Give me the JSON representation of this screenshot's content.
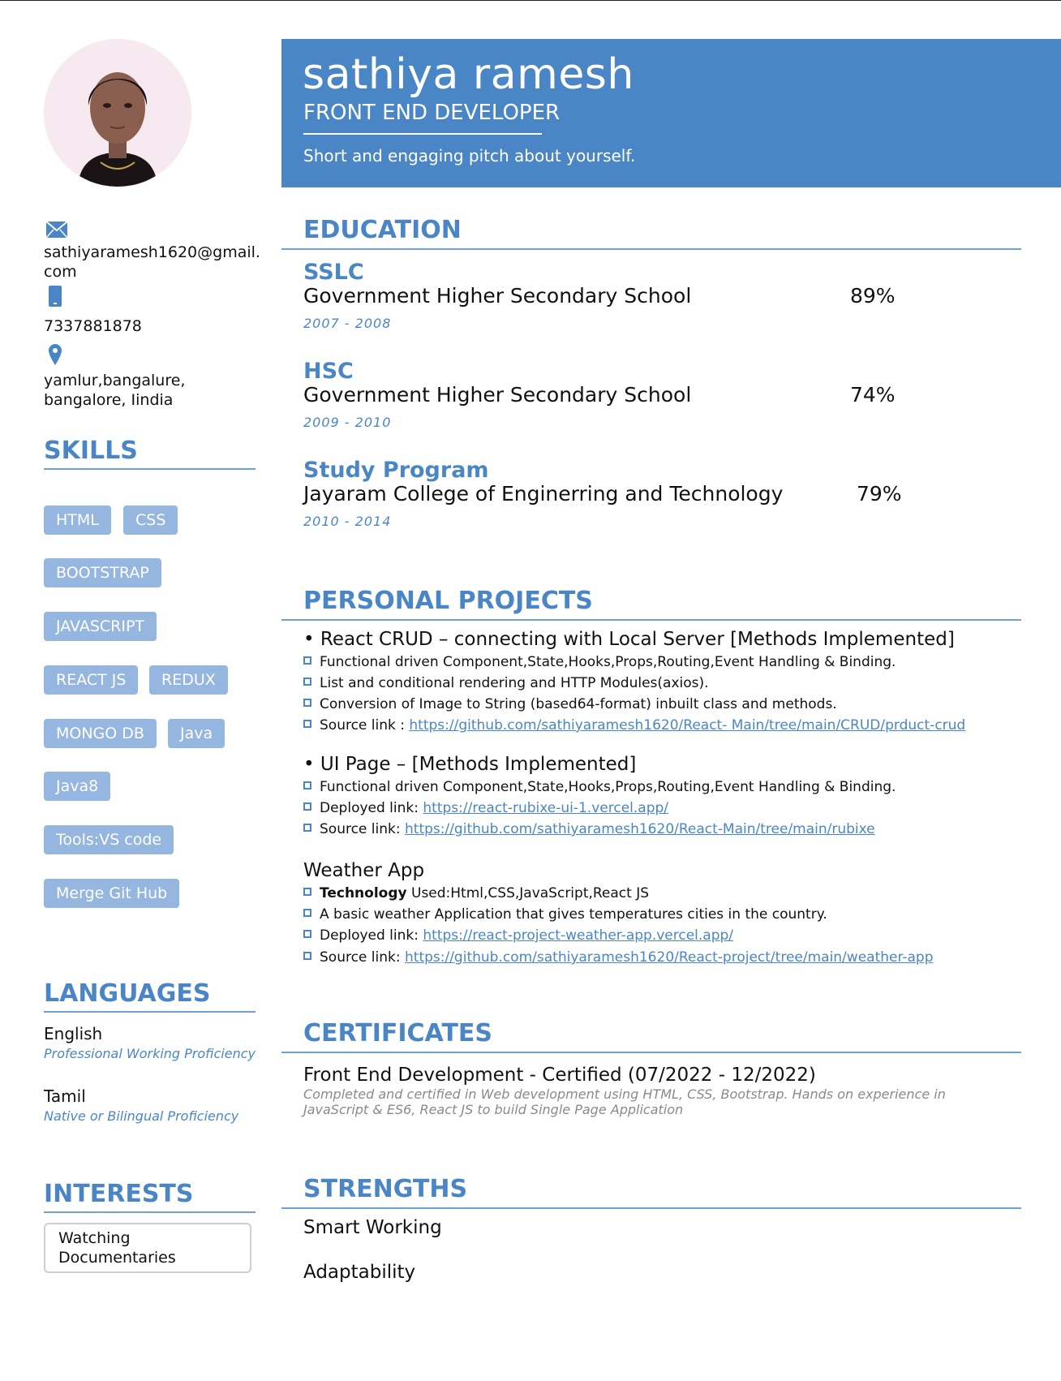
{
  "profile": {
    "name": "sathiya ramesh",
    "role": "FRONT END DEVELOPER",
    "pitch": "Short and engaging pitch about yourself."
  },
  "contact": {
    "email": "sathiyaramesh1620@gmail.com",
    "phone": "7337881878",
    "address_line1": "yamlur,bangalure,",
    "address_line2": "bangalore, Iindia",
    "icons": [
      "envelope-icon",
      "phone-icon",
      "location-pin-icon"
    ]
  },
  "skills": {
    "heading": "SKILLS",
    "items": [
      "HTML",
      "CSS",
      "BOOTSTRAP",
      "JAVASCRIPT",
      "REACT JS",
      "REDUX",
      "MONGO DB",
      "Java",
      "Java8",
      "Tools:VS code",
      "Merge Git Hub"
    ]
  },
  "languages": {
    "heading": "LANGUAGES",
    "items": [
      {
        "name": "English",
        "level": "Professional Working Proficiency"
      },
      {
        "name": "Tamil",
        "level": "Native or Bilingual Proficiency"
      }
    ]
  },
  "interests": {
    "heading": "INTERESTS",
    "items": [
      "Watching Documentaries"
    ]
  },
  "education": {
    "heading": "EDUCATION",
    "items": [
      {
        "level": "SSLC",
        "school": "Government Higher Secondary School",
        "score": "89%",
        "years": "2007 - 2008"
      },
      {
        "level": "HSC",
        "school": "Government Higher Secondary School",
        "score": "74%",
        "years": "2009 - 2010"
      },
      {
        "level": "Study Program",
        "school": "Jayaram College of Enginerring and Technology",
        "score": "79%",
        "years": "2010 - 2014"
      }
    ]
  },
  "projects": {
    "heading": "PERSONAL PROJECTS",
    "items": [
      {
        "title": "• React CRUD – connecting with Local Server [Methods Implemented]",
        "bullets": [
          "Functional driven Component,State,Hooks,Props,Routing,Event Handling & Binding.",
          "List and conditional rendering and HTTP Modules(axios).",
          "Conversion of Image to String (based64-format) inbuilt class and methods."
        ],
        "source_label": "Source link : ",
        "source_url": "https://github.com/sathiyaramesh1620/React- Main/tree/main/CRUD/prduct-crud"
      },
      {
        "title": "• UI Page – [Methods Implemented]",
        "bullets": [
          "Functional driven Component,State,Hooks,Props,Routing,Event Handling & Binding."
        ],
        "deployed_label": "Deployed link: ",
        "deployed_url": "https://react-rubixe-ui-1.vercel.app/",
        "source_label": "Source link: ",
        "source_url": "https://github.com/sathiyaramesh1620/React-Main/tree/main/rubixe"
      },
      {
        "title": "Weather App",
        "tech_label": "Technology",
        "tech_value": " Used:Html,CSS,JavaScript,React JS",
        "bullets": [
          "A basic weather Application that gives temperatures cities in the country."
        ],
        "deployed_label": "Deployed link: ",
        "deployed_url": "https://react-project-weather-app.vercel.app/",
        "source_label": "Source link: ",
        "source_url": "https://github.com/sathiyaramesh1620/React-project/tree/main/weather-app"
      }
    ]
  },
  "certificates": {
    "heading": "CERTIFICATES",
    "items": [
      {
        "title": "Front End Development - Certified (07/2022 - 12/2022)",
        "description": "Completed and certified in Web development using HTML, CSS, Bootstrap. Hands on experience in JavaScript & ES6, React JS to build Single Page Application"
      }
    ]
  },
  "strengths": {
    "heading": "STRENGTHS",
    "items": [
      "Smart Working",
      "Adaptability"
    ]
  },
  "colors": {
    "accent": "#4a86c6",
    "chip": "#94b6df",
    "muted": "#8a8a8a"
  }
}
